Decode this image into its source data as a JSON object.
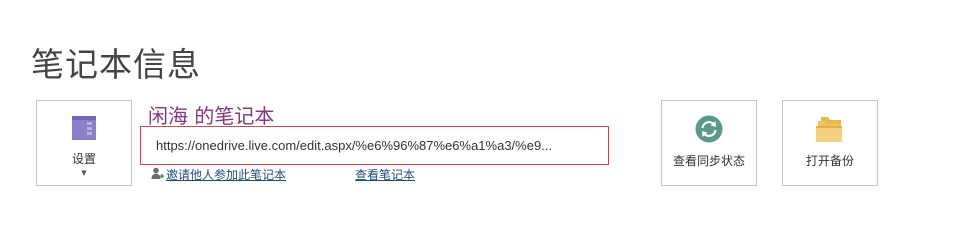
{
  "page": {
    "title": "笔记本信息"
  },
  "settings": {
    "label": "设置",
    "caret_icon": "chevron-down-icon",
    "icon": "notebook-icon",
    "icon_color": "#8b7fc8"
  },
  "notebook": {
    "name": "闲海 的笔记本",
    "name_color": "#80397b",
    "url": "https://onedrive.live.com/edit.aspx/%e6%96%87%e6%a1%a3/%e9...",
    "url_border_color": "#c0504d",
    "invite_label": "邀请他人参加此笔记本",
    "invite_icon": "add-person-icon",
    "view_label": "查看笔记本"
  },
  "sync": {
    "label": "查看同步状态",
    "icon": "sync-icon",
    "icon_color": "#5b9a8b"
  },
  "backup": {
    "label": "打开备份",
    "icon": "folder-icon",
    "icon_color": "#f2c867"
  }
}
